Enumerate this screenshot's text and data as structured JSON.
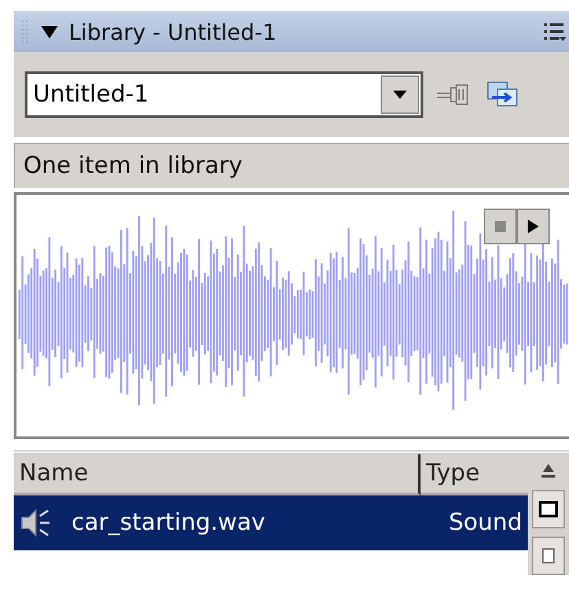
{
  "panel": {
    "title": "Library - Untitled-1",
    "expanded": true
  },
  "document_select": {
    "value": "Untitled-1"
  },
  "status": "One item in library",
  "preview": {
    "kind": "sound"
  },
  "table": {
    "columns": [
      "Name",
      "Type"
    ],
    "rows": [
      {
        "name": "car_starting.wav",
        "type": "Sound",
        "kind": "sound",
        "selected": true
      }
    ]
  }
}
